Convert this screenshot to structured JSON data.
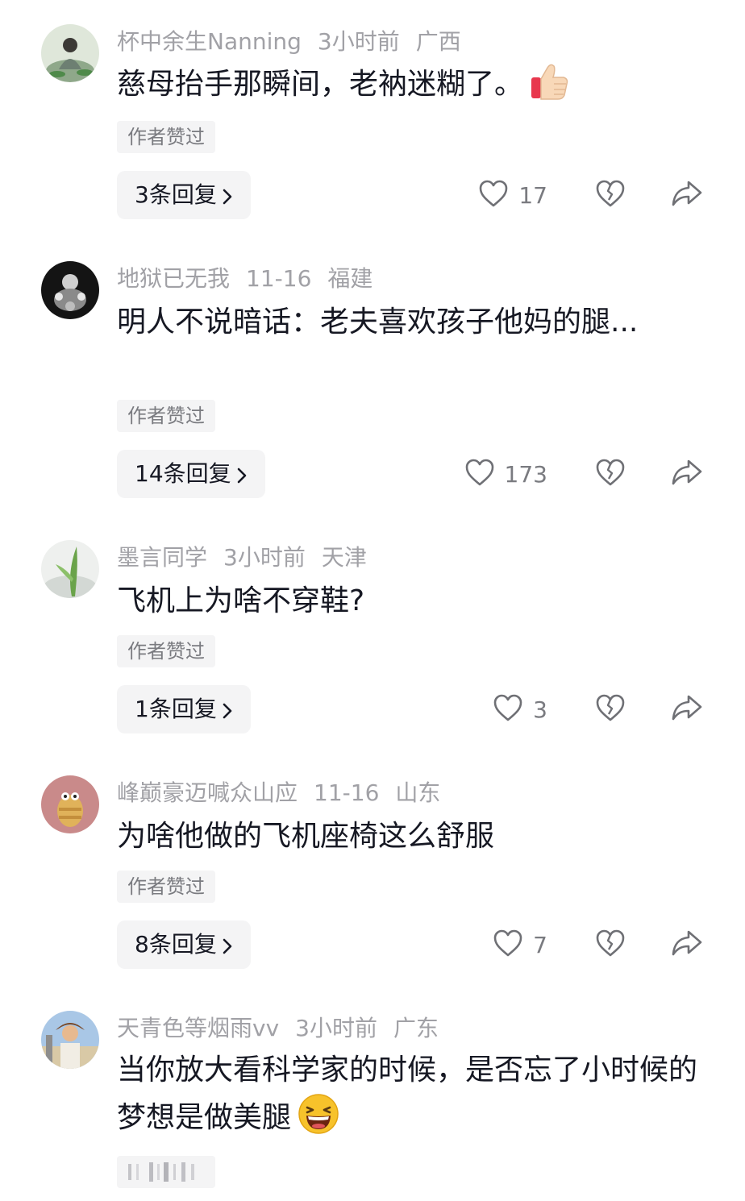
{
  "comments": [
    {
      "username": "杯中余生Nanning",
      "time": "3小时前",
      "location": "广西",
      "text": "慈母抬手那瞬间，老衲迷糊了。",
      "emoji": "thumbs-up-icon",
      "author_liked": "作者赞过",
      "replies": "3条回复",
      "likes": "17"
    },
    {
      "username": "地狱已无我",
      "time": "11-16",
      "location": "福建",
      "text": "明人不说暗话：老夫喜欢孩子他妈的腿...",
      "author_liked": "作者赞过",
      "replies": "14条回复",
      "likes": "173"
    },
    {
      "username": "墨言同学",
      "time": "3小时前",
      "location": "天津",
      "text": "飞机上为啥不穿鞋?",
      "author_liked": "作者赞过",
      "replies": "1条回复",
      "likes": "3"
    },
    {
      "username": "峰巅豪迈喊众山应",
      "time": "11-16",
      "location": "山东",
      "text": "为啥他做的飞机座椅这么舒服",
      "author_liked": "作者赞过",
      "replies": "8条回复",
      "likes": "7"
    },
    {
      "username": "天青色等烟雨vv",
      "time": "3小时前",
      "location": "广东",
      "text": "当你放大看科学家的时候，是否忘了小时候的梦想是做美腿",
      "emoji": "grinning-squint-face-icon"
    }
  ],
  "colors": {
    "meta_text": "#a1a1a6",
    "body_text": "#161823",
    "pill_bg": "#f4f4f5",
    "icon_stroke": "#6f7075"
  }
}
